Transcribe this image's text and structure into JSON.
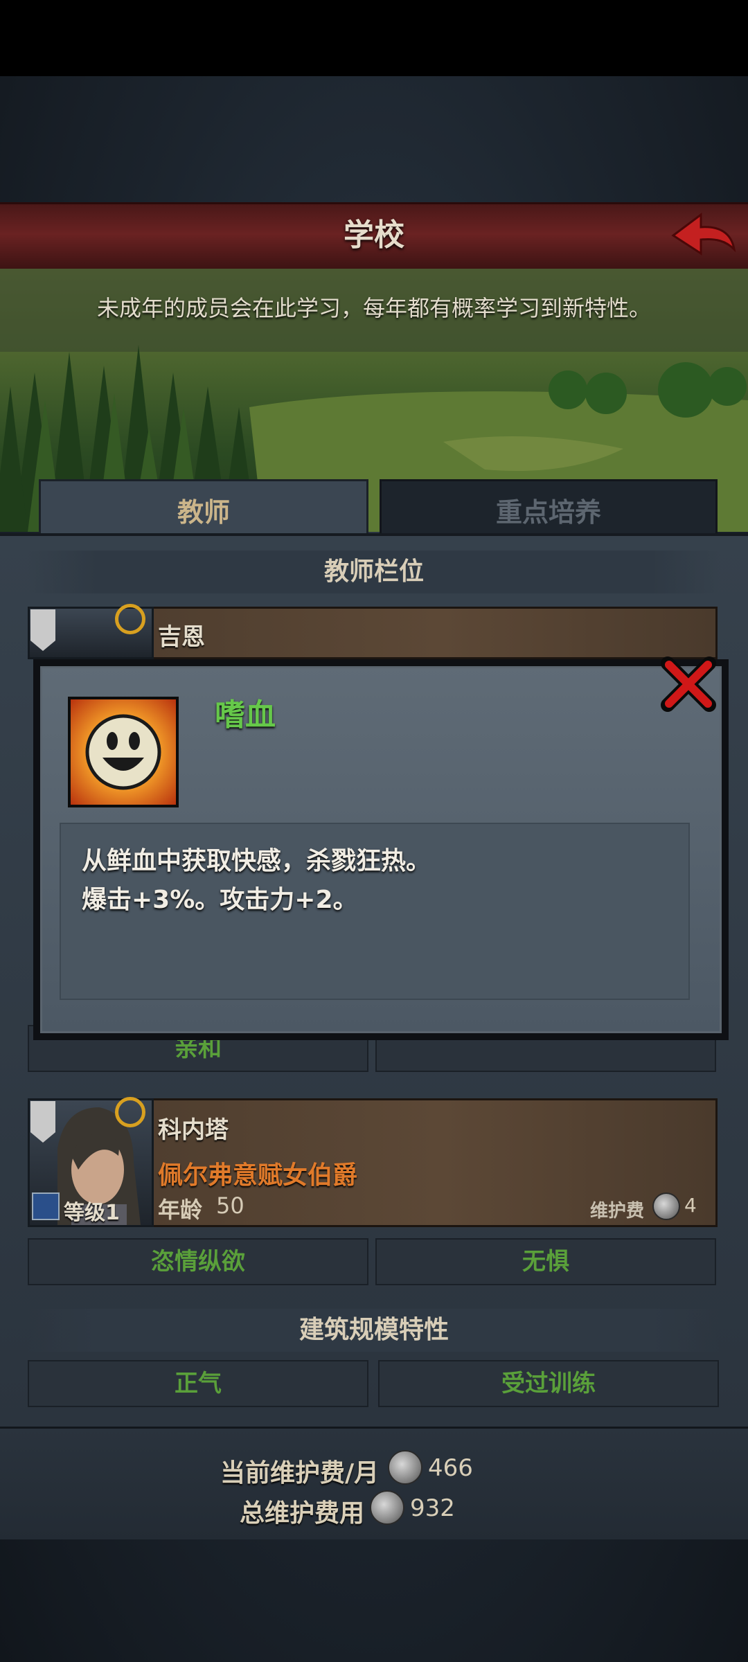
{
  "header": {
    "title": "学校"
  },
  "banner": {
    "description": "未成年的成员会在此学习，每年都有概率学习到新特性。"
  },
  "tabs": [
    {
      "label": "教师"
    },
    {
      "label": "重点培养"
    }
  ],
  "teacher_slots": {
    "heading": "教师栏位",
    "teachers": [
      {
        "name": "吉恩",
        "traits": [
          "亲和",
          ""
        ]
      },
      {
        "name": "科内塔",
        "title": "佩尔弗意赋女伯爵",
        "age_label": "年龄",
        "age": "50",
        "level_label": "等级1",
        "upkeep_label": "维护费",
        "upkeep": "4",
        "traits": [
          "恣情纵欲",
          "无惧"
        ]
      }
    ]
  },
  "building_traits": {
    "heading": "建筑规模特性",
    "traits": [
      "正气",
      "受过训练"
    ]
  },
  "popup": {
    "trait_name": "嗜血",
    "description_line1": "从鲜血中获取快感，杀戮狂热。",
    "description_line2": "爆击+3%。攻击力+2。",
    "icon": "smiley-face-icon"
  },
  "footer": {
    "monthly_upkeep_label": "当前维护费/月",
    "monthly_upkeep": "466",
    "total_upkeep_label": "总维护费用",
    "total_upkeep": "932"
  },
  "colors": {
    "trait_green": "#5aa03a",
    "title_red": "#6a2222",
    "accent_gold": "#cbb58a"
  }
}
